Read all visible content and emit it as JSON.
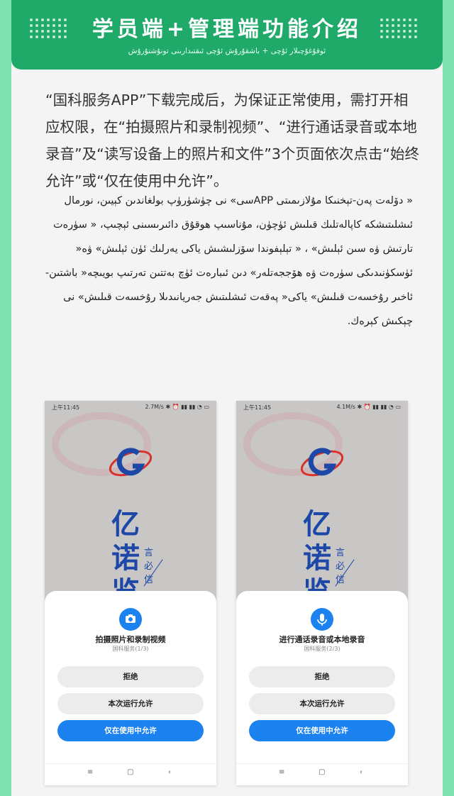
{
  "header": {
    "title": "学员端+管理端功能介绍",
    "subtitle": "ئوقۇغۇچىلار ئۇچى + باشقۇرۇش ئۇچى ئىقتىدارىنى تونۇشتۇرۇش"
  },
  "intro_cn": "“国科服务APP”下载完成后，为保证正常使用，需打开相应权限，在“拍摄照片和录制视频”、“进行通话录音或本地录音”及“读写设备上的照片和文件”3个页面依次点击“始终允许”或“仅在使用中允许”。",
  "intro_ug": "« دۆلەت پەن-تېخنىكا مۇلازىمىتى APPسى» نى چۈشۈرۈپ بولغاندىن كېيىن، نورمال ئىشلىتىشكە كاپالەتلىك قىلىش ئۈچۈن، مۇناسىپ ھوقۇق دائىرىسىنى ئېچىپ، « سۈرەت تارتىش ۋە سىن ئېلىش» ، « تېلېفوندا سۆزلىشىش ياكى يەرلىك ئۈن ئېلىش» ۋە« ئۈسكۈنىدىكى سۈرەت ۋە ھۆججەتلەر» دىن ئىبارەت ئۈچ بەتتىن تەرتىپ بويىچە« باشتىن-ئاخىر رۇخسەت قىلىش» ياكى« پەقەت ئىشلىتىش جەريانىدىلا رۇخسەت قىلىش» نى چېكىش كېرەك.",
  "phones": [
    {
      "status_time": "上午11:45",
      "status_right": "2.7M/s ✱ ⏰ ▮▮ ▮▮ ◔ ▭",
      "brand_big": "亿诺览",
      "brand_small": "言必信",
      "permission_title": "拍摄照片和录制视频",
      "permission_sub": "国科服务(1/3)",
      "icon": "camera-icon",
      "buttons": [
        "拒绝",
        "本次运行允许",
        "仅在使用中允许"
      ],
      "nav": [
        "≡",
        "▢",
        "‹"
      ]
    },
    {
      "status_time": "上午11:45",
      "status_right": "4.1M/s ✱ ⏰ ▮▮ ▮▮ ◔ ▭",
      "brand_big": "亿诺览",
      "brand_small": "言必信",
      "permission_title": "进行通话录音或本地录音",
      "permission_sub": "国科服务(2/3)",
      "icon": "microphone-icon",
      "buttons": [
        "拒绝",
        "本次运行允许",
        "仅在使用中允许"
      ],
      "nav": [
        "≡",
        "▢",
        "‹"
      ]
    }
  ],
  "colors": {
    "brand_green": "#1faa6a",
    "page_bg": "#7fe0b0",
    "accent_blue": "#1b82f0"
  }
}
